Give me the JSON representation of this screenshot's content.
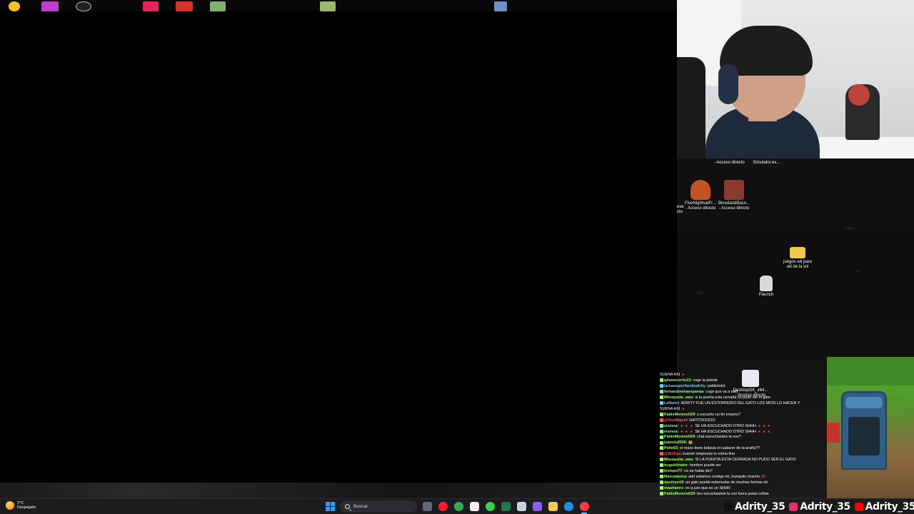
{
  "desktop": {
    "top_labels": [
      "- Acceso directo",
      "Simulator.ex..."
    ],
    "icons": [
      {
        "label_line1": "FiveNightsatFr...",
        "label_line2": "- Acceso directo",
        "color": "#c4531f"
      },
      {
        "label_line1": "BloodandBaco...",
        "label_line2": "- Acceso directo",
        "color": "#8a3b2e"
      },
      {
        "label_line1": "juegos wii para",
        "label_line2": "wii de la wii",
        "color": "#f2c94c"
      },
      {
        "label_line1": "Paunch",
        "label_line2": "",
        "color": "#d9d9d9"
      },
      {
        "label_line1": "DesktopOK_x64...",
        "label_line2": "- Acceso directo",
        "color": "#e9e9f2"
      }
    ],
    "left_edge_label": [
      "ese",
      "cto"
    ]
  },
  "chat": {
    "messages": [
      {
        "user": "",
        "user_color": "#ffffff",
        "text": "SUENA ASI 🔺"
      },
      {
        "user": "gitanocorrio23",
        "user_color": "#9bff6a",
        "text": "coge la pistola"
      },
      {
        "user": "larisasuperfandeadrity",
        "user_color": "#5fd3ff",
        "text": "pabliototot"
      },
      {
        "user": "fernandovivaespanaa",
        "user_color": "#7dffb0",
        "text": "coge que va a salir"
      },
      {
        "user": "Mixuqueta_uwu",
        "user_color": "#a9ff6a",
        "text": "si la puerta esta cerrada no pudo ser el gato"
      },
      {
        "user": "LeNainx",
        "user_color": "#5fd3ff",
        "text": "ADRITY FUE UN ESTORNUDO DEL GATO LOS MIOS LO HACEN Y"
      },
      {
        "user": "",
        "user_color": "#ffffff",
        "text": "SUENA ASI 🔺"
      },
      {
        "user": "PabloMoreno029",
        "user_color": "#9bff6a",
        "text": "s escucho un tio enserio?"
      },
      {
        "user": "@SoyMiguel",
        "user_color": "#ff5a5a",
        "text": "GATITOOOOO"
      },
      {
        "user": "elsinna",
        "user_color": "#7dffb0",
        "text": "🔺🔺🔺 SE HA ESCUCHADO OTRO SHHH 🔺🔺🔺"
      },
      {
        "user": "elsinna",
        "user_color": "#7dffb0",
        "text": "🔺🔺🔺 SE HA ESCUCHADO OTRO SHHH 🔺🔺🔺"
      },
      {
        "user": "PabloMoreno029",
        "user_color": "#9bff6a",
        "text": "chat escuchasteis la voz?"
      },
      {
        "user": "juanelo2026",
        "user_color": "#9bff6a",
        "text": "🤠"
      },
      {
        "user": "Polin55",
        "user_color": "#a9ff6a",
        "text": "el mazo tiene todavia el cadaver de la araña??"
      },
      {
        "user": "@Bellisa",
        "user_color": "#ff5a5a",
        "text": "cuando empiezas tu rutina fina"
      },
      {
        "user": "Mixuqueta_uwu",
        "user_color": "#a9ff6a",
        "text": "SI LA PUERTA ESTA CERRADA NO PUDO SER EL GATO"
      },
      {
        "user": "hugoblinator",
        "user_color": "#9bff6a",
        "text": "hombre puede ser"
      },
      {
        "user": "breispv77",
        "user_color": "#a9ff6a",
        "text": "no se habia ido?"
      },
      {
        "user": "Marcalavera",
        "user_color": "#9bff6a",
        "text": "adri estamos contigo eh, tranquilo chacho 💯"
      },
      {
        "user": "danilmert3",
        "user_color": "#9bff6a",
        "text": "un gato puede estornudar de muchas formas eh"
      },
      {
        "user": "maarlamrz",
        "user_color": "#9bff6a",
        "text": "es q juro que es un SHHH"
      },
      {
        "user": "PabloMoreno029",
        "user_color": "#9bff6a",
        "text": "bro escuchasteis la voz fuera putas coñas"
      }
    ]
  },
  "taskbar": {
    "weather_temp": "7°C",
    "weather_condition": "Despejado",
    "search_placeholder": "Buscar",
    "apps": [
      {
        "name": "file-manager-icon",
        "color": "#5e6a7a"
      },
      {
        "name": "opera-icon",
        "color": "#ff1b2d"
      },
      {
        "name": "chrome-icon",
        "color": "#34a853"
      },
      {
        "name": "document-icon",
        "color": "#f2f2f2"
      },
      {
        "name": "xbox-icon",
        "color": "#3ccf4e"
      },
      {
        "name": "excel-icon",
        "color": "#1f7a45"
      },
      {
        "name": "steam-icon",
        "color": "#c7d5e0"
      },
      {
        "name": "obs-icon",
        "color": "#8b5cf6"
      },
      {
        "name": "folder-icon",
        "color": "#f2c94c"
      },
      {
        "name": "edge-icon",
        "color": "#1a8fe3"
      },
      {
        "name": "recording-icon",
        "color": "#ff3b3b"
      }
    ]
  },
  "social": [
    {
      "icon": "tiktok-icon",
      "handle": "Adrity_35",
      "color": "#111111"
    },
    {
      "icon": "instagram-icon",
      "handle": "Adrity_35",
      "color": "#e1306c"
    },
    {
      "icon": "youtube-icon",
      "handle": "Adrity_35",
      "color": "#ff0000"
    }
  ]
}
